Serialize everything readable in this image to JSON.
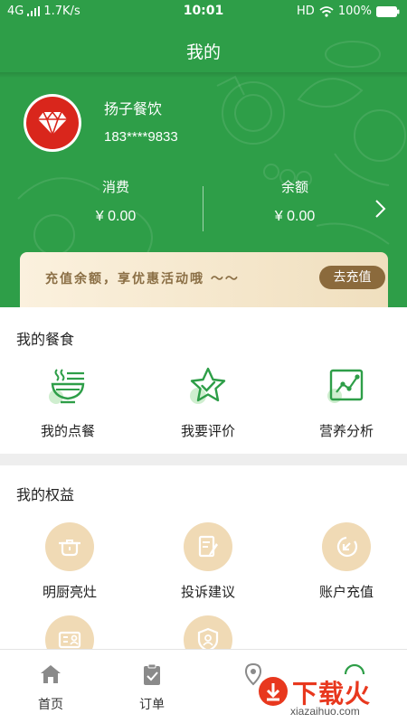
{
  "status_bar": {
    "network": "4G",
    "speed": "1.7K/s",
    "time": "10:01",
    "hd": "HD",
    "battery": "100%"
  },
  "header": {
    "title": "我的"
  },
  "profile": {
    "name": "扬子餐饮",
    "phone": "183****9833"
  },
  "stats": {
    "consume_label": "消费",
    "consume_value": "¥ 0.00",
    "balance_label": "余额",
    "balance_value": "¥ 0.00"
  },
  "promo": {
    "text": "充值余额，享优惠活动哦 ～～",
    "button": "去充值"
  },
  "my_food": {
    "title": "我的餐食",
    "items": [
      {
        "label": "我的点餐",
        "icon": "bowl-icon"
      },
      {
        "label": "我要评价",
        "icon": "star-icon"
      },
      {
        "label": "营养分析",
        "icon": "chart-icon"
      }
    ]
  },
  "my_perks": {
    "title": "我的权益",
    "items": [
      {
        "label": "明厨亮灶",
        "icon": "stove-icon"
      },
      {
        "label": "投诉建议",
        "icon": "document-pen-icon"
      },
      {
        "label": "账户充值",
        "icon": "recharge-icon"
      },
      {
        "label": "",
        "icon": "id-card-icon"
      },
      {
        "label": "",
        "icon": "shield-user-icon"
      }
    ]
  },
  "tabbar": {
    "items": [
      {
        "label": "首页",
        "icon": "home-icon"
      },
      {
        "label": "订单",
        "icon": "clipboard-icon"
      },
      {
        "label": "",
        "icon": "location-icon"
      },
      {
        "label": "",
        "icon": "profile-icon"
      }
    ]
  },
  "watermark": {
    "text": "下载火",
    "url": "xiazaihuo.com"
  },
  "colors": {
    "primary_green": "#2e9e48",
    "promo_brown": "#8b6a3c",
    "perk_circle": "#f0dab5",
    "avatar_red": "#d9261c"
  }
}
